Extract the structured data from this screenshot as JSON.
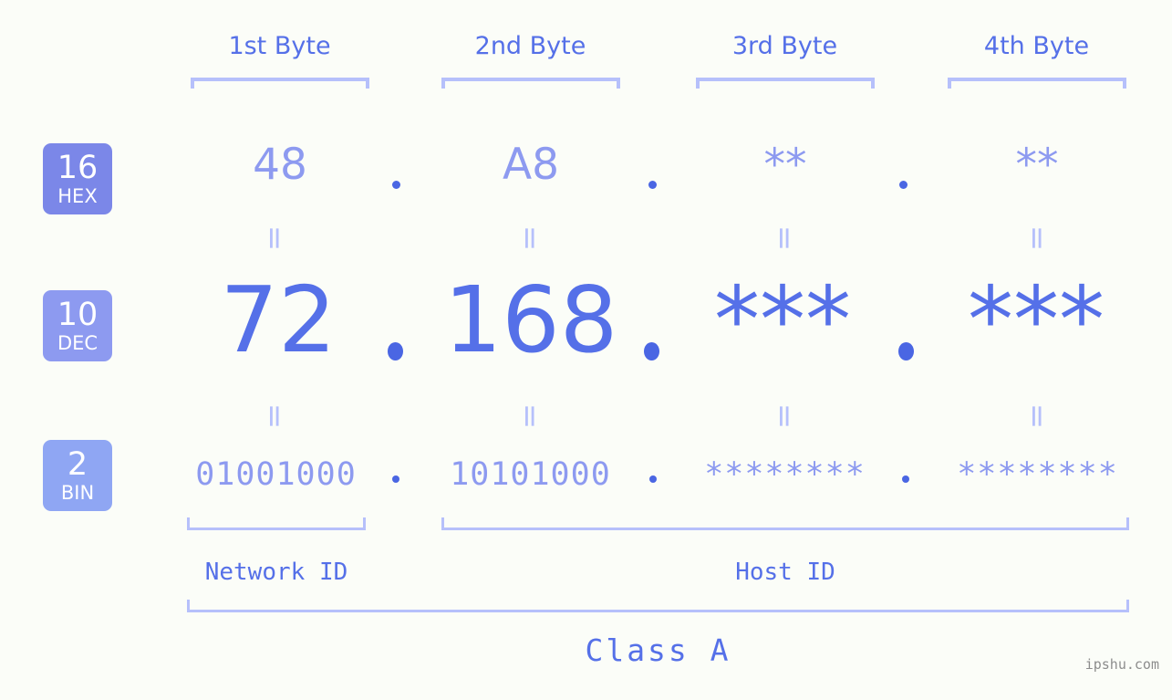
{
  "background_color": "#fbfdf8",
  "accent_color": "#5570e8",
  "accent_light_color": "#8d9af0",
  "bracket_color": "#b6c0fb",
  "byte_headers": [
    {
      "label": "1st Byte"
    },
    {
      "label": "2nd Byte"
    },
    {
      "label": "3rd Byte"
    },
    {
      "label": "4th Byte"
    }
  ],
  "rows": [
    {
      "badge_number": "16",
      "badge_name": "HEX",
      "badge_color": "#7b87e8",
      "values": [
        "48",
        "A8",
        "**",
        "**"
      ],
      "separator": "."
    },
    {
      "badge_number": "10",
      "badge_name": "DEC",
      "badge_color": "#8d9af0",
      "values": [
        "72",
        "168",
        "***",
        "***"
      ],
      "separator": "."
    },
    {
      "badge_number": "2",
      "badge_name": "BIN",
      "badge_color": "#8fa6f3",
      "values": [
        "01001000",
        "10101000",
        "********",
        "********"
      ],
      "separator": "."
    }
  ],
  "equals_glyph": "=",
  "segments": {
    "network_id": "Network ID",
    "host_id": "Host ID"
  },
  "class_label": "Class A",
  "watermark": "ipshu.com"
}
